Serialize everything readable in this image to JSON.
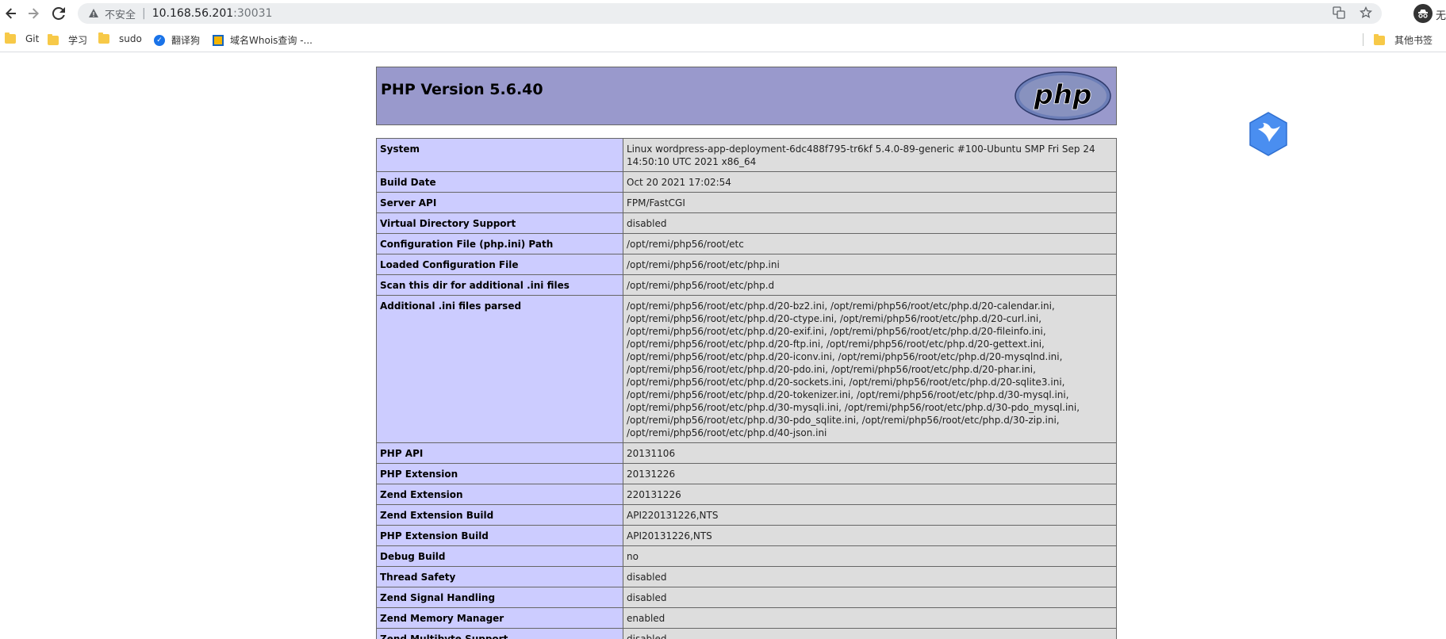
{
  "browser": {
    "insecure_label": "不安全",
    "url_host": "10.168.56.201",
    "url_port": ":30031",
    "profile_label": "无"
  },
  "bookmarks": [
    {
      "label": "Git",
      "icon": "folder-icon"
    },
    {
      "label": "学习",
      "icon": "folder-icon"
    },
    {
      "label": "sudo",
      "icon": "folder-icon"
    },
    {
      "label": "翻译狗",
      "icon": "sogou-icon"
    },
    {
      "label": "域名Whois查询 -...",
      "icon": "whois-icon"
    },
    {
      "label": "其他书签",
      "icon": "folder-icon"
    }
  ],
  "page": {
    "title": "PHP Version 5.6.40",
    "logo_text": "php"
  },
  "rows": [
    {
      "key": "System",
      "value": "Linux wordpress-app-deployment-6dc488f795-tr6kf 5.4.0-89-generic #100-Ubuntu SMP Fri Sep 24 14:50:10 UTC 2021 x86_64"
    },
    {
      "key": "Build Date",
      "value": "Oct 20 2021 17:02:54"
    },
    {
      "key": "Server API",
      "value": "FPM/FastCGI"
    },
    {
      "key": "Virtual Directory Support",
      "value": "disabled"
    },
    {
      "key": "Configuration File (php.ini) Path",
      "value": "/opt/remi/php56/root/etc"
    },
    {
      "key": "Loaded Configuration File",
      "value": "/opt/remi/php56/root/etc/php.ini"
    },
    {
      "key": "Scan this dir for additional .ini files",
      "value": "/opt/remi/php56/root/etc/php.d"
    },
    {
      "key": "Additional .ini files parsed",
      "value": "/opt/remi/php56/root/etc/php.d/20-bz2.ini, /opt/remi/php56/root/etc/php.d/20-calendar.ini, /opt/remi/php56/root/etc/php.d/20-ctype.ini, /opt/remi/php56/root/etc/php.d/20-curl.ini, /opt/remi/php56/root/etc/php.d/20-exif.ini, /opt/remi/php56/root/etc/php.d/20-fileinfo.ini, /opt/remi/php56/root/etc/php.d/20-ftp.ini, /opt/remi/php56/root/etc/php.d/20-gettext.ini, /opt/remi/php56/root/etc/php.d/20-iconv.ini, /opt/remi/php56/root/etc/php.d/20-mysqlnd.ini, /opt/remi/php56/root/etc/php.d/20-pdo.ini, /opt/remi/php56/root/etc/php.d/20-phar.ini, /opt/remi/php56/root/etc/php.d/20-sockets.ini, /opt/remi/php56/root/etc/php.d/20-sqlite3.ini, /opt/remi/php56/root/etc/php.d/20-tokenizer.ini, /opt/remi/php56/root/etc/php.d/30-mysql.ini, /opt/remi/php56/root/etc/php.d/30-mysqli.ini, /opt/remi/php56/root/etc/php.d/30-pdo_mysql.ini, /opt/remi/php56/root/etc/php.d/30-pdo_sqlite.ini, /opt/remi/php56/root/etc/php.d/30-zip.ini, /opt/remi/php56/root/etc/php.d/40-json.ini"
    },
    {
      "key": "PHP API",
      "value": "20131106"
    },
    {
      "key": "PHP Extension",
      "value": "20131226"
    },
    {
      "key": "Zend Extension",
      "value": "220131226"
    },
    {
      "key": "Zend Extension Build",
      "value": "API220131226,NTS"
    },
    {
      "key": "PHP Extension Build",
      "value": "API20131226,NTS"
    },
    {
      "key": "Debug Build",
      "value": "no"
    },
    {
      "key": "Thread Safety",
      "value": "disabled"
    },
    {
      "key": "Zend Signal Handling",
      "value": "disabled"
    },
    {
      "key": "Zend Memory Manager",
      "value": "enabled"
    },
    {
      "key": "Zend Multibyte Support",
      "value": "disabled"
    }
  ]
}
